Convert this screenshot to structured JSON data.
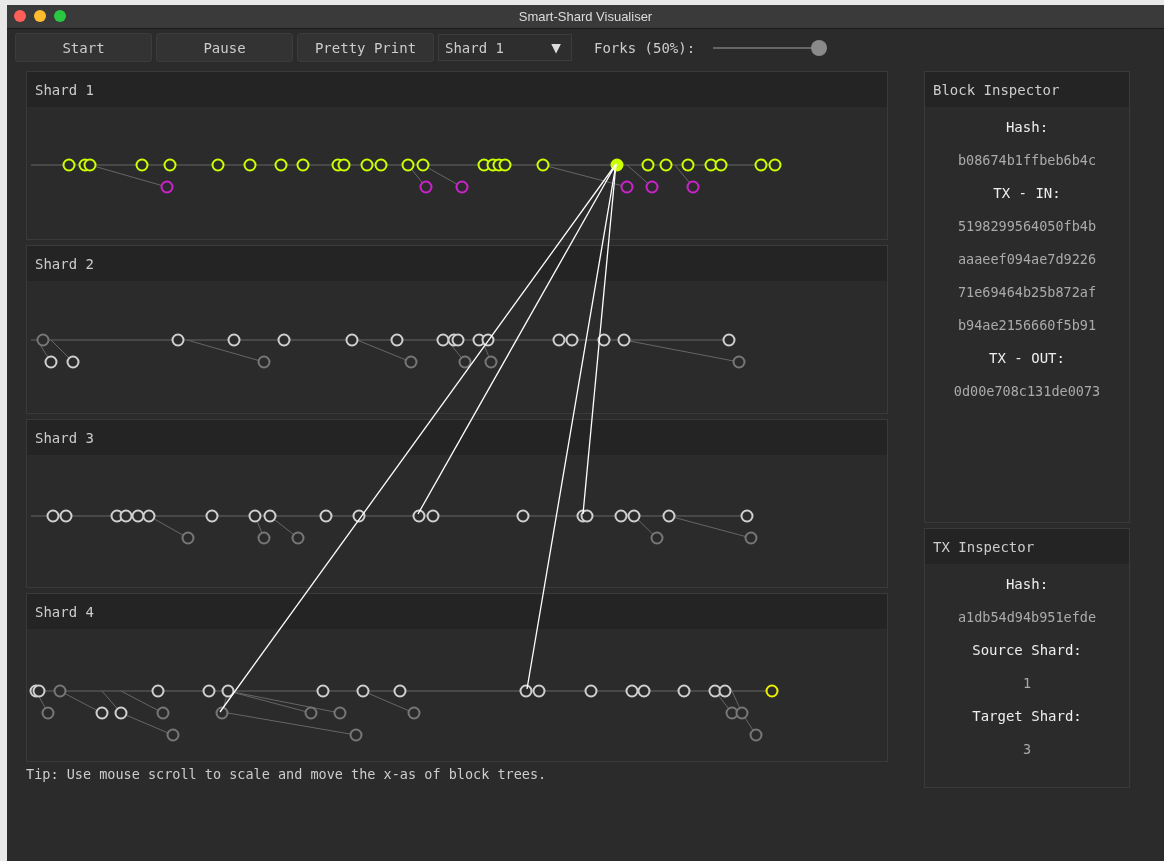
{
  "window": {
    "title": "Smart-Shard Visualiser"
  },
  "toolbar": {
    "buttons": [
      "Start",
      "Pause",
      "Pretty Print"
    ],
    "shard_select": {
      "value": "Shard 1",
      "arrow": "▼"
    },
    "forks": {
      "label": "Forks (50%):",
      "level": 1.0
    }
  },
  "shards": [
    {
      "title": "Shard 1"
    },
    {
      "title": "Shard 2"
    },
    {
      "title": "Shard 3"
    },
    {
      "title": "Shard 4"
    }
  ],
  "tip": "Tip: Use mouse scroll to scale and move the x-as of block trees.",
  "block_inspector": {
    "title": "Block Inspector",
    "lines": [
      {
        "kind": "label",
        "text": "Hash:"
      },
      {
        "kind": "value",
        "text": "b08674b1ffbeb6b4c"
      },
      {
        "kind": "label",
        "text": "TX - IN:"
      },
      {
        "kind": "value",
        "text": "5198299564050fb4b"
      },
      {
        "kind": "value",
        "text": "aaaeef094ae7d9226"
      },
      {
        "kind": "value",
        "text": "71e69464b25b872af"
      },
      {
        "kind": "value",
        "text": "b94ae2156660f5b91"
      },
      {
        "kind": "label",
        "text": "TX - OUT:"
      },
      {
        "kind": "value",
        "text": "0d00e708c131de0073"
      }
    ]
  },
  "tx_inspector": {
    "title": "TX Inspector",
    "lines": [
      {
        "kind": "label",
        "text": "Hash:"
      },
      {
        "kind": "value",
        "text": "a1db54d94b951efde"
      },
      {
        "kind": "label",
        "text": "Source Shard:"
      },
      {
        "kind": "value",
        "text": "1"
      },
      {
        "kind": "label",
        "text": "Target Shard:"
      },
      {
        "kind": "value",
        "text": "3"
      }
    ]
  }
}
